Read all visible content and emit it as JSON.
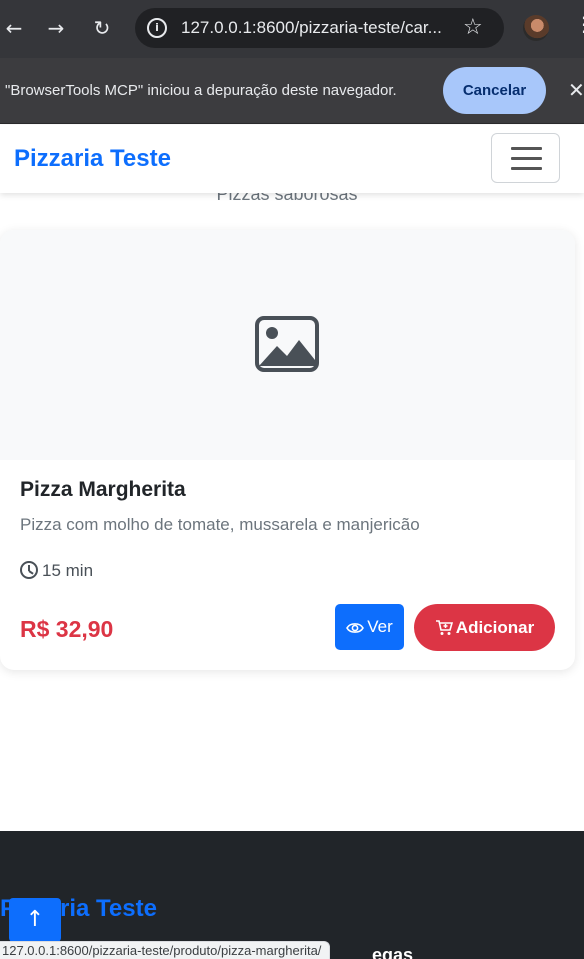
{
  "browser": {
    "url": "127.0.0.1:8600/pizzaria-teste/car...",
    "debug_message": "\"BrowserTools MCP\" iniciou a depuração deste navegador.",
    "debug_cancel_label": "Cancelar"
  },
  "navbar": {
    "brand": "Pizzaria Teste"
  },
  "section": {
    "subtitle": "Pizzas saborosas"
  },
  "product": {
    "name": "Pizza Margherita",
    "description": "Pizza com molho de tomate, mussarela e manjericão",
    "time": "15 min",
    "price": "R$ 32,90",
    "view_label": "Ver",
    "add_label": "Adicionar"
  },
  "footer": {
    "brand": "Pizzaria Teste",
    "next_heading_fragment": "egas"
  },
  "status_bar": {
    "link_url": "127.0.0.1:8600/pizzaria-teste/produto/pizza-margherita/"
  },
  "colors": {
    "primary": "#0d6efd",
    "danger": "#dc3545",
    "footer_bg": "#212529"
  }
}
